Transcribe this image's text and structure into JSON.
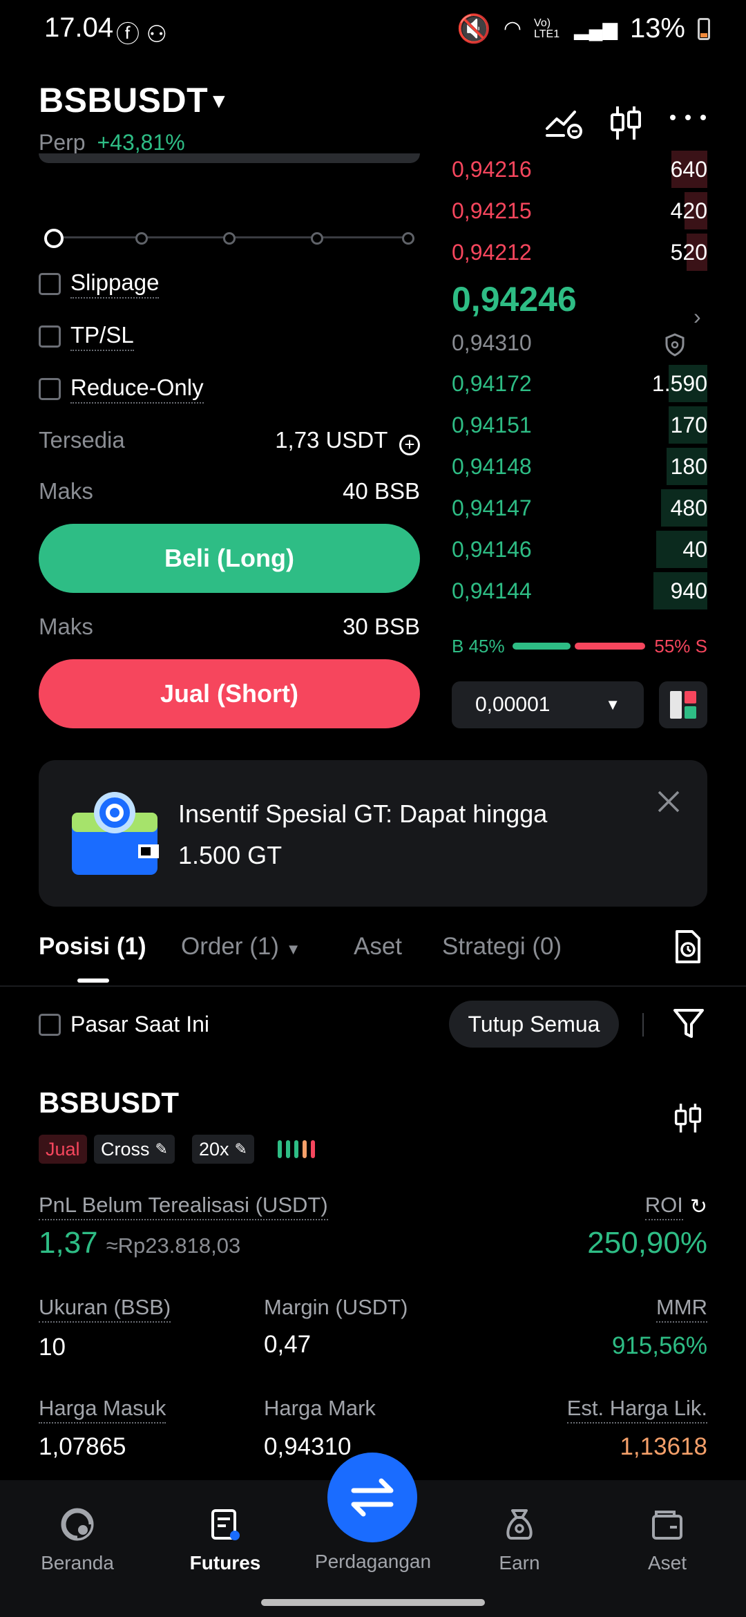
{
  "status_bar": {
    "time": "17.04",
    "battery": "13%",
    "network": "Vo) LTE1"
  },
  "header": {
    "pair": "BSBUSDT",
    "market": "Perp",
    "change": "+43,81%"
  },
  "order_form": {
    "options": [
      {
        "label": "Slippage"
      },
      {
        "label": "TP/SL"
      },
      {
        "label": "Reduce-Only"
      }
    ],
    "available_label": "Tersedia",
    "available_value": "1,73 USDT",
    "max_buy_label": "Maks",
    "max_buy_value": "40 BSB",
    "buy_button": "Beli (Long)",
    "max_sell_label": "Maks",
    "max_sell_value": "30 BSB",
    "sell_button": "Jual (Short)"
  },
  "order_book": {
    "asks": [
      {
        "price": "0,94216",
        "qty": "640",
        "depth": 0.14
      },
      {
        "price": "0,94215",
        "qty": "420",
        "depth": 0.09
      },
      {
        "price": "0,94212",
        "qty": "520",
        "depth": 0.08
      }
    ],
    "last_price": "0,94246",
    "mark_price": "0,94310",
    "bids": [
      {
        "price": "0,94172",
        "qty": "1.590",
        "depth": 0.15
      },
      {
        "price": "0,94151",
        "qty": "170",
        "depth": 0.15
      },
      {
        "price": "0,94148",
        "qty": "180",
        "depth": 0.16
      },
      {
        "price": "0,94147",
        "qty": "480",
        "depth": 0.18
      },
      {
        "price": "0,94146",
        "qty": "40",
        "depth": 0.2
      },
      {
        "price": "0,94144",
        "qty": "940",
        "depth": 0.21
      }
    ],
    "buy_ratio": "B 45%",
    "sell_ratio": "55% S",
    "buy_fraction": 0.45,
    "tick_size": "0,00001"
  },
  "promo": {
    "line1": "Insentif Spesial GT: Dapat hingga",
    "line2": "1.500 GT"
  },
  "tabs": [
    {
      "label": "Posisi (1)"
    },
    {
      "label": "Order (1)"
    },
    {
      "label": "Aset"
    },
    {
      "label": "Strategi (0)"
    }
  ],
  "filter": {
    "current_market": "Pasar Saat Ini",
    "close_all": "Tutup Semua"
  },
  "position": {
    "pair": "BSBUSDT",
    "side": "Jual",
    "mode": "Cross",
    "leverage": "20x",
    "pnl_label": "PnL Belum Terealisasi (USDT)",
    "pnl_value": "1,37",
    "pnl_idr": "≈Rp23.818,03",
    "roi_label": "ROI",
    "roi_value": "250,90%",
    "size_label": "Ukuran (BSB)",
    "size_value": "10",
    "margin_label": "Margin (USDT)",
    "margin_value": "0,47",
    "mmr_label": "MMR",
    "mmr_value": "915,56%",
    "entry_label": "Harga Masuk",
    "entry_value": "1,07865",
    "mark_label": "Harga Mark",
    "mark_value": "0,94310",
    "liq_label": "Est. Harga Lik.",
    "liq_value": "1,13618"
  },
  "nav": [
    {
      "label": "Beranda",
      "icon": "home-icon"
    },
    {
      "label": "Futures",
      "icon": "futures-icon"
    },
    {
      "label": "Perdagangan",
      "icon": "swap-icon"
    },
    {
      "label": "Earn",
      "icon": "earn-icon"
    },
    {
      "label": "Aset",
      "icon": "wallet-icon"
    }
  ],
  "colors": {
    "green": "#2ebd85",
    "red": "#f6465d",
    "accent_blue": "#1a6cff",
    "liq_orange": "#f5a06a"
  }
}
